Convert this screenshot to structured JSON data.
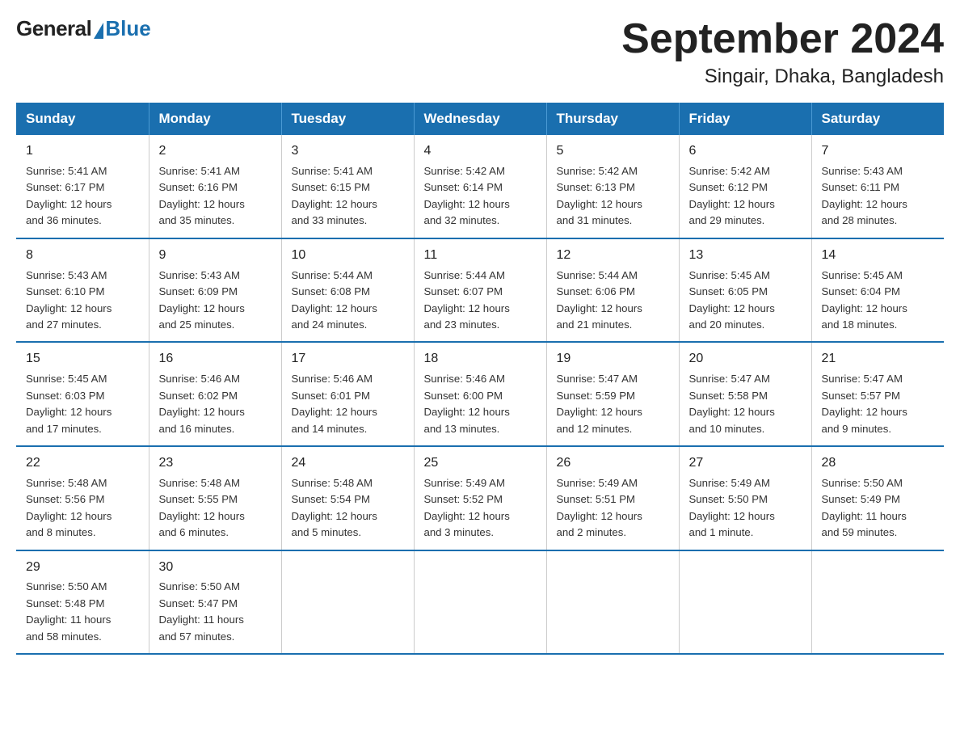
{
  "logo": {
    "general": "General",
    "blue": "Blue"
  },
  "title": "September 2024",
  "subtitle": "Singair, Dhaka, Bangladesh",
  "days_header": [
    "Sunday",
    "Monday",
    "Tuesday",
    "Wednesday",
    "Thursday",
    "Friday",
    "Saturday"
  ],
  "weeks": [
    [
      {
        "day": "1",
        "sunrise": "5:41 AM",
        "sunset": "6:17 PM",
        "daylight": "12 hours and 36 minutes."
      },
      {
        "day": "2",
        "sunrise": "5:41 AM",
        "sunset": "6:16 PM",
        "daylight": "12 hours and 35 minutes."
      },
      {
        "day": "3",
        "sunrise": "5:41 AM",
        "sunset": "6:15 PM",
        "daylight": "12 hours and 33 minutes."
      },
      {
        "day": "4",
        "sunrise": "5:42 AM",
        "sunset": "6:14 PM",
        "daylight": "12 hours and 32 minutes."
      },
      {
        "day": "5",
        "sunrise": "5:42 AM",
        "sunset": "6:13 PM",
        "daylight": "12 hours and 31 minutes."
      },
      {
        "day": "6",
        "sunrise": "5:42 AM",
        "sunset": "6:12 PM",
        "daylight": "12 hours and 29 minutes."
      },
      {
        "day": "7",
        "sunrise": "5:43 AM",
        "sunset": "6:11 PM",
        "daylight": "12 hours and 28 minutes."
      }
    ],
    [
      {
        "day": "8",
        "sunrise": "5:43 AM",
        "sunset": "6:10 PM",
        "daylight": "12 hours and 27 minutes."
      },
      {
        "day": "9",
        "sunrise": "5:43 AM",
        "sunset": "6:09 PM",
        "daylight": "12 hours and 25 minutes."
      },
      {
        "day": "10",
        "sunrise": "5:44 AM",
        "sunset": "6:08 PM",
        "daylight": "12 hours and 24 minutes."
      },
      {
        "day": "11",
        "sunrise": "5:44 AM",
        "sunset": "6:07 PM",
        "daylight": "12 hours and 23 minutes."
      },
      {
        "day": "12",
        "sunrise": "5:44 AM",
        "sunset": "6:06 PM",
        "daylight": "12 hours and 21 minutes."
      },
      {
        "day": "13",
        "sunrise": "5:45 AM",
        "sunset": "6:05 PM",
        "daylight": "12 hours and 20 minutes."
      },
      {
        "day": "14",
        "sunrise": "5:45 AM",
        "sunset": "6:04 PM",
        "daylight": "12 hours and 18 minutes."
      }
    ],
    [
      {
        "day": "15",
        "sunrise": "5:45 AM",
        "sunset": "6:03 PM",
        "daylight": "12 hours and 17 minutes."
      },
      {
        "day": "16",
        "sunrise": "5:46 AM",
        "sunset": "6:02 PM",
        "daylight": "12 hours and 16 minutes."
      },
      {
        "day": "17",
        "sunrise": "5:46 AM",
        "sunset": "6:01 PM",
        "daylight": "12 hours and 14 minutes."
      },
      {
        "day": "18",
        "sunrise": "5:46 AM",
        "sunset": "6:00 PM",
        "daylight": "12 hours and 13 minutes."
      },
      {
        "day": "19",
        "sunrise": "5:47 AM",
        "sunset": "5:59 PM",
        "daylight": "12 hours and 12 minutes."
      },
      {
        "day": "20",
        "sunrise": "5:47 AM",
        "sunset": "5:58 PM",
        "daylight": "12 hours and 10 minutes."
      },
      {
        "day": "21",
        "sunrise": "5:47 AM",
        "sunset": "5:57 PM",
        "daylight": "12 hours and 9 minutes."
      }
    ],
    [
      {
        "day": "22",
        "sunrise": "5:48 AM",
        "sunset": "5:56 PM",
        "daylight": "12 hours and 8 minutes."
      },
      {
        "day": "23",
        "sunrise": "5:48 AM",
        "sunset": "5:55 PM",
        "daylight": "12 hours and 6 minutes."
      },
      {
        "day": "24",
        "sunrise": "5:48 AM",
        "sunset": "5:54 PM",
        "daylight": "12 hours and 5 minutes."
      },
      {
        "day": "25",
        "sunrise": "5:49 AM",
        "sunset": "5:52 PM",
        "daylight": "12 hours and 3 minutes."
      },
      {
        "day": "26",
        "sunrise": "5:49 AM",
        "sunset": "5:51 PM",
        "daylight": "12 hours and 2 minutes."
      },
      {
        "day": "27",
        "sunrise": "5:49 AM",
        "sunset": "5:50 PM",
        "daylight": "12 hours and 1 minute."
      },
      {
        "day": "28",
        "sunrise": "5:50 AM",
        "sunset": "5:49 PM",
        "daylight": "11 hours and 59 minutes."
      }
    ],
    [
      {
        "day": "29",
        "sunrise": "5:50 AM",
        "sunset": "5:48 PM",
        "daylight": "11 hours and 58 minutes."
      },
      {
        "day": "30",
        "sunrise": "5:50 AM",
        "sunset": "5:47 PM",
        "daylight": "11 hours and 57 minutes."
      },
      null,
      null,
      null,
      null,
      null
    ]
  ],
  "labels": {
    "sunrise": "Sunrise: ",
    "sunset": "Sunset: ",
    "daylight": "Daylight: "
  }
}
